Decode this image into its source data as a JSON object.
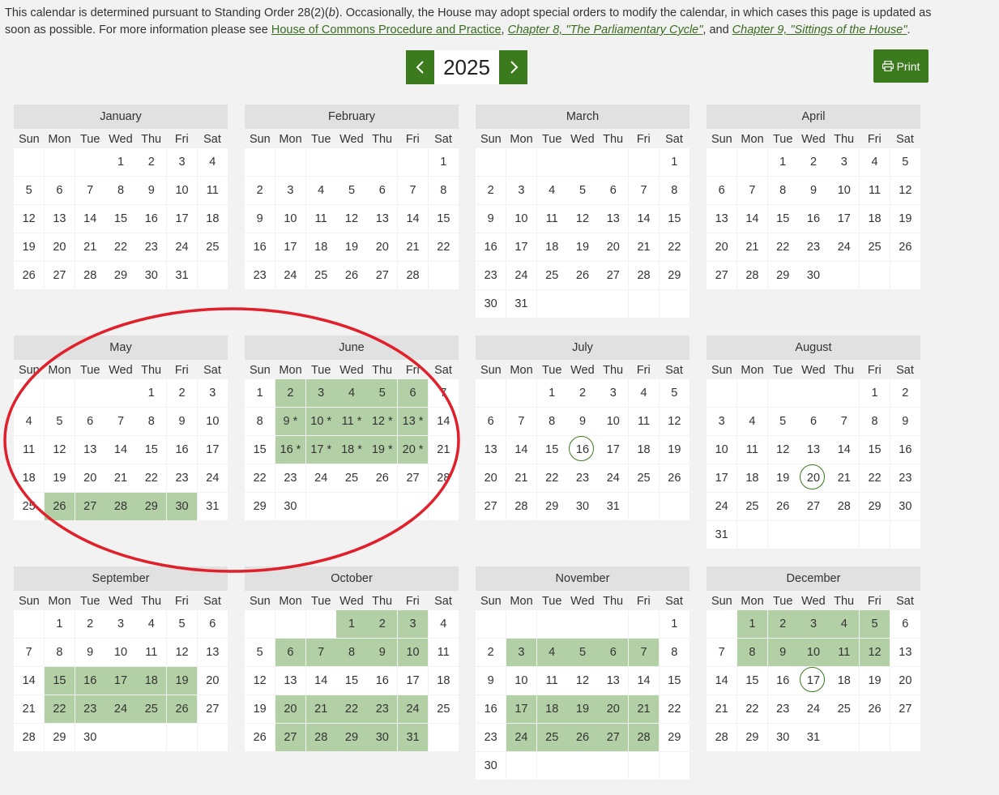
{
  "intro": {
    "text_part1": "This calendar is determined pursuant to Standing Order 28(2)(",
    "text_b": "b",
    "text_part2": "). Occasionally, the House may adopt special orders to modify the calendar, in which cases this page is updated as soon as possible. For more information please see ",
    "link1": "House of Commons Procedure and Practice",
    "sep1": ", ",
    "link2": "Chapter 8, \"The Parliamentary Cycle\"",
    "sep2": ", and ",
    "link3": "Chapter 9, \"Sittings of the House\"",
    "end": "."
  },
  "year_nav": {
    "year": "2025",
    "prev_icon": "chevron-left-icon",
    "next_icon": "chevron-right-icon"
  },
  "print_button": {
    "label": "Print",
    "icon": "printer-icon"
  },
  "colors": {
    "accent": "#3b7a1d",
    "sitting_day": "#b3cfa5",
    "annotation_ellipse": "#e0202a"
  },
  "weekdays": [
    "Sun",
    "Mon",
    "Tue",
    "Wed",
    "Thu",
    "Fri",
    "Sat"
  ],
  "months": [
    {
      "name": "January",
      "start": 3,
      "days": 31,
      "sitting": [],
      "star": [],
      "marked": []
    },
    {
      "name": "February",
      "start": 6,
      "days": 28,
      "sitting": [],
      "star": [],
      "marked": []
    },
    {
      "name": "March",
      "start": 6,
      "days": 31,
      "sitting": [],
      "star": [],
      "marked": []
    },
    {
      "name": "April",
      "start": 2,
      "days": 30,
      "sitting": [],
      "star": [],
      "marked": []
    },
    {
      "name": "May",
      "start": 4,
      "days": 31,
      "sitting": [
        26,
        27,
        28,
        29,
        30
      ],
      "star": [],
      "marked": []
    },
    {
      "name": "June",
      "start": 0,
      "days": 30,
      "sitting": [
        2,
        3,
        4,
        5,
        6,
        9,
        10,
        11,
        12,
        13,
        16,
        17,
        18,
        19,
        20
      ],
      "star": [
        9,
        10,
        11,
        12,
        13,
        16,
        17,
        18,
        19,
        20
      ],
      "marked": []
    },
    {
      "name": "July",
      "start": 2,
      "days": 31,
      "sitting": [],
      "star": [],
      "marked": [
        16
      ]
    },
    {
      "name": "August",
      "start": 5,
      "days": 31,
      "sitting": [],
      "star": [],
      "marked": [
        20
      ]
    },
    {
      "name": "September",
      "start": 1,
      "days": 30,
      "sitting": [
        15,
        16,
        17,
        18,
        19,
        22,
        23,
        24,
        25,
        26
      ],
      "star": [],
      "marked": []
    },
    {
      "name": "October",
      "start": 3,
      "days": 31,
      "sitting": [
        1,
        2,
        3,
        6,
        7,
        8,
        9,
        10,
        20,
        21,
        22,
        23,
        24,
        27,
        28,
        29,
        30,
        31
      ],
      "star": [],
      "marked": []
    },
    {
      "name": "November",
      "start": 6,
      "days": 30,
      "sitting": [
        3,
        4,
        5,
        6,
        7,
        17,
        18,
        19,
        20,
        21,
        24,
        25,
        26,
        27,
        28
      ],
      "star": [],
      "marked": []
    },
    {
      "name": "December",
      "start": 1,
      "days": 31,
      "sitting": [
        1,
        2,
        3,
        4,
        5,
        8,
        9,
        10,
        11,
        12
      ],
      "star": [],
      "marked": [
        17
      ]
    }
  ]
}
